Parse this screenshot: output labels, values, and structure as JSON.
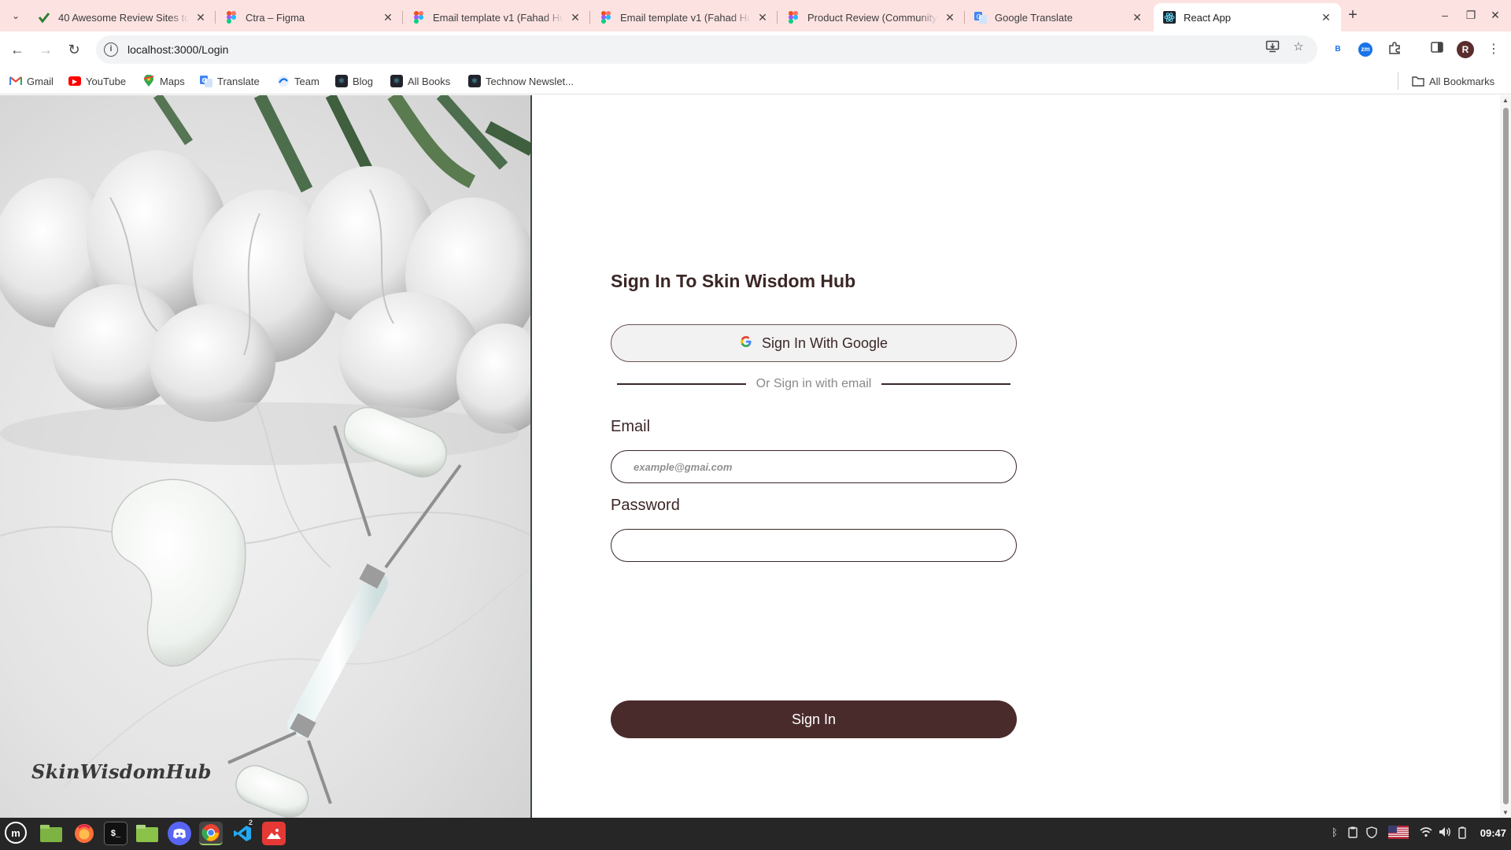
{
  "browser": {
    "tabs": [
      {
        "title": "40 Awesome Review Sites to",
        "icon": "check-icon",
        "active": false
      },
      {
        "title": "Ctra – Figma",
        "icon": "figma-icon",
        "active": false
      },
      {
        "title": "Email template v1 (Fahad Hu",
        "icon": "figma-icon",
        "active": false
      },
      {
        "title": "Email template v1 (Fahad Hu",
        "icon": "figma-icon",
        "active": false
      },
      {
        "title": "Product Review (Community",
        "icon": "figma-icon",
        "active": false
      },
      {
        "title": "Google Translate",
        "icon": "translate-icon",
        "active": false
      },
      {
        "title": "React App",
        "icon": "react-icon",
        "active": true
      }
    ],
    "url": "localhost:3000/Login",
    "extension_b": "B",
    "extension_zm": "zm",
    "profile_initial": "R",
    "bookmarks": [
      {
        "label": "Gmail",
        "icon": "gmail-icon"
      },
      {
        "label": "YouTube",
        "icon": "youtube-icon"
      },
      {
        "label": "Maps",
        "icon": "maps-icon"
      },
      {
        "label": "Translate",
        "icon": "translate-icon"
      },
      {
        "label": "Team",
        "icon": "team-icon"
      },
      {
        "label": "Blog",
        "icon": "blog-icon"
      },
      {
        "label": "All Books",
        "icon": "books-icon"
      },
      {
        "label": "Technow Newslet...",
        "icon": "newsletter-icon"
      }
    ],
    "all_bookmarks": "All Bookmarks"
  },
  "page": {
    "brand": "SkinWisdomHub",
    "heading": "Sign In To Skin Wisdom Hub",
    "google_button": "Sign In With Google",
    "divider_text": "Or Sign in with email",
    "email_label": "Email",
    "email_placeholder": "example@gmai.com",
    "email_value": "",
    "password_label": "Password",
    "password_value": "",
    "signin_button": "Sign In",
    "colors": {
      "accent": "#4a2b2b",
      "heading": "#3b2626"
    }
  },
  "taskbar": {
    "workspace_badge": "2",
    "clock": "09:47"
  }
}
